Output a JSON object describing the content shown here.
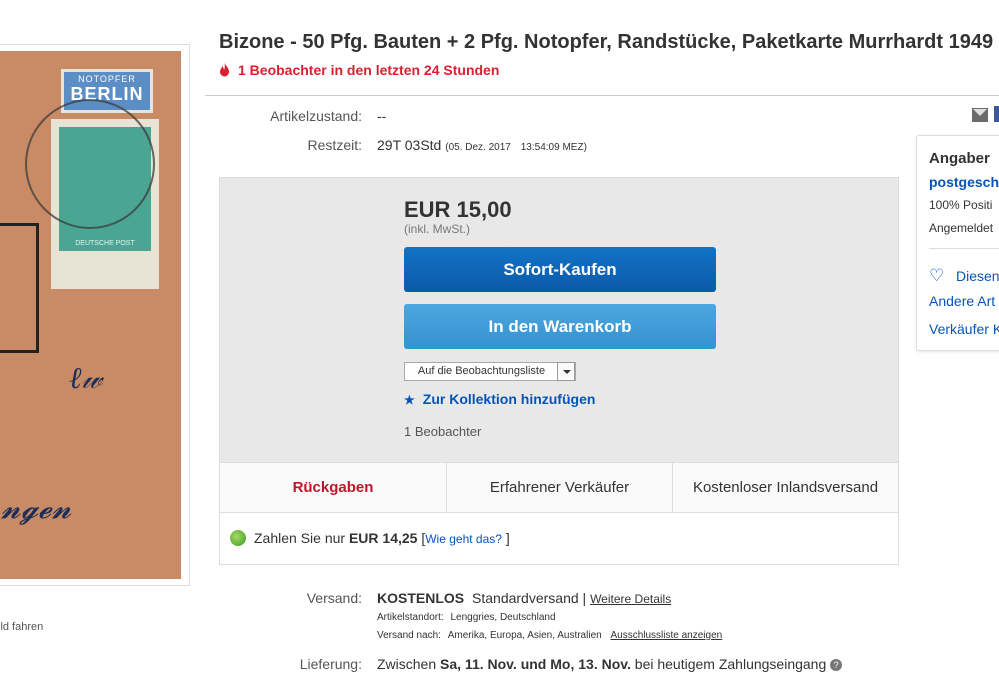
{
  "image": {
    "stamp_top_small": "NOTOPFER",
    "stamp_top_big": "BERLIN",
    "stamp_main_bottom": "DEUTSCHE POST",
    "caption": "ild fahren"
  },
  "title": "Bizone - 50 Pfg. Bauten + 2 Pfg. Notopfer, Randstücke, Paketkarte Murrhardt 1949",
  "watchers_banner": "1 Beobachter in den letzten 24 Stunden",
  "condition": {
    "label": "Artikelzustand:",
    "value": "--"
  },
  "time_left": {
    "label": "Restzeit:",
    "value": "29T 03Std",
    "end": "(05. Dez. 2017",
    "end_time": "13:54:09 MEZ)"
  },
  "buybox": {
    "price": "EUR 15,00",
    "vat": "(inkl. MwSt.)",
    "buy_now": "Sofort-Kaufen",
    "add_to_cart": "In den Warenkorb",
    "watch_select": "Auf die Beobachtungsliste",
    "collection": "Zur Kollektion hinzufügen",
    "watch_count": "1 Beobachter",
    "tabs": [
      "Rückgaben",
      "Erfahrener Verkäufer",
      "Kostenloser Inlandsversand"
    ],
    "pay_prefix": "Zahlen Sie nur",
    "pay_amount": "EUR 14,25",
    "pay_open": "[",
    "pay_link": "Wie geht das?",
    "pay_close": "]"
  },
  "shipping": {
    "label": "Versand:",
    "free": "KOSTENLOS",
    "service": "Standardversand |",
    "details_link": "Weitere Details",
    "location_label": "Artikelstandort:",
    "location": "Lenggries, Deutschland",
    "to_label": "Versand nach:",
    "to": "Amerika, Europa, Asien, Australien",
    "exclusions_link": "Ausschlussliste anzeigen"
  },
  "delivery": {
    "label": "Lieferung:",
    "prefix": "Zwischen",
    "range": "Sa, 11. Nov. und Mo, 13. Nov.",
    "suffix": "bei heutigem Zahlungseingang"
  },
  "seller": {
    "heading": "Angaber",
    "name": "postgesch",
    "feedback": "100% Positi",
    "registered": "Angemeldet",
    "save": "Diesen",
    "other_items": "Andere Art",
    "contact": "Verkäufer K"
  },
  "colors": {
    "link": "#0654ba",
    "alert": "#dd1e31",
    "buy": "#0b5aa8",
    "cart": "#3592d0"
  }
}
